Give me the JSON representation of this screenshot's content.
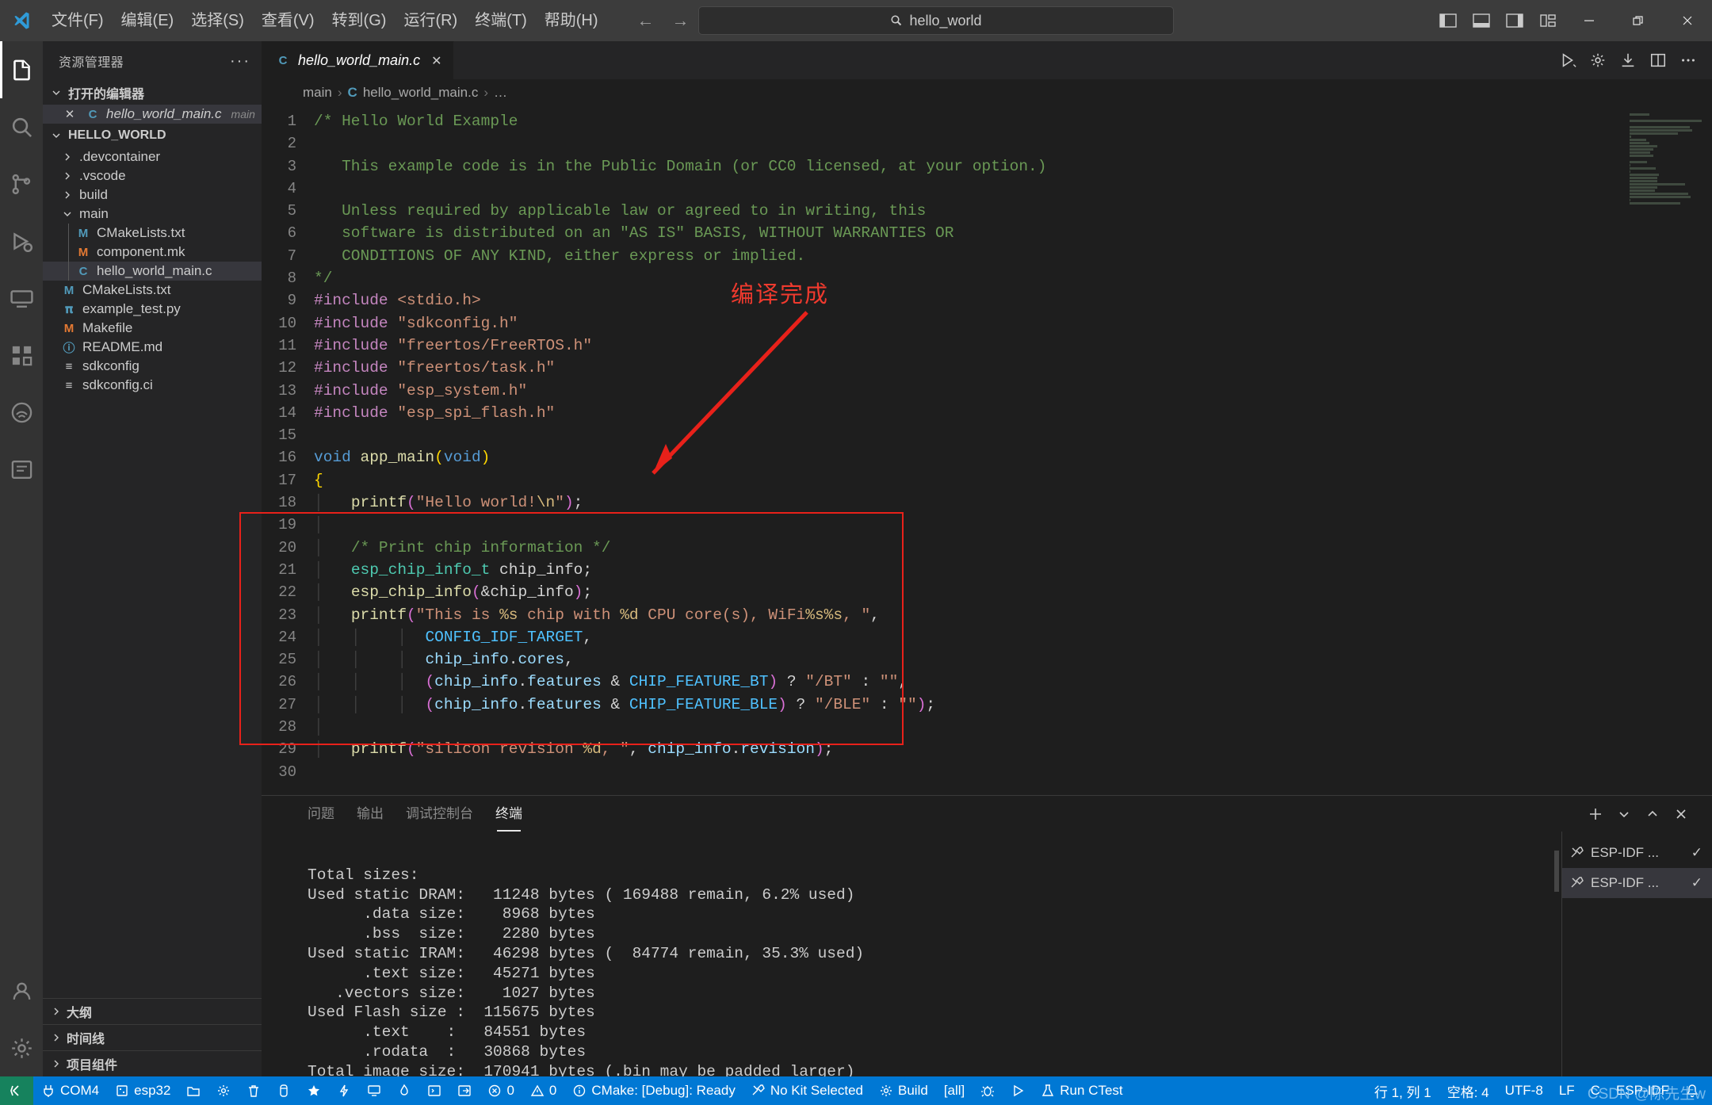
{
  "titlebar": {
    "logo_icon": "vscode-logo",
    "menus": [
      "文件(F)",
      "编辑(E)",
      "选择(S)",
      "查看(V)",
      "转到(G)",
      "运行(R)",
      "终端(T)",
      "帮助(H)"
    ],
    "nav_back_icon": "arrow-left-icon",
    "nav_forward_icon": "arrow-right-icon",
    "search": {
      "text": "hello_world",
      "icon": "search-icon"
    },
    "layout_icons": [
      "toggle-primary-sidebar-icon",
      "toggle-panel-icon",
      "toggle-secondary-sidebar-icon",
      "customize-layout-icon"
    ],
    "window_controls": [
      "minimize-icon",
      "restore-icon",
      "close-icon"
    ]
  },
  "activitybar": {
    "items": [
      {
        "name": "explorer",
        "icon": "files-icon",
        "active": true
      },
      {
        "name": "search",
        "icon": "search-icon",
        "active": false
      },
      {
        "name": "source-control",
        "icon": "source-control-icon",
        "active": false
      },
      {
        "name": "run-and-debug",
        "icon": "debug-icon",
        "active": false
      },
      {
        "name": "remote-explorer",
        "icon": "remote-icon",
        "active": false
      },
      {
        "name": "extensions",
        "icon": "extensions-icon",
        "active": false
      },
      {
        "name": "espressif-idf",
        "icon": "espressif-icon",
        "active": false
      },
      {
        "name": "cmake",
        "icon": "cmake-icon",
        "active": false
      }
    ],
    "bottom_items": [
      {
        "name": "accounts",
        "icon": "account-icon"
      },
      {
        "name": "manage",
        "icon": "gear-icon"
      }
    ]
  },
  "sidebar": {
    "title": "资源管理器",
    "more_actions": "···",
    "open_editors": {
      "label": "打开的编辑器",
      "items": [
        {
          "close": "✕",
          "icon": "c-file-icon",
          "name": "hello_world_main.c",
          "folder": "main",
          "selected": true
        }
      ]
    },
    "project": {
      "label": "HELLO_WORLD",
      "items": [
        {
          "depth": 1,
          "kind": "folder",
          "expanded": false,
          "name": ".devcontainer"
        },
        {
          "depth": 1,
          "kind": "folder",
          "expanded": false,
          "name": ".vscode"
        },
        {
          "depth": 1,
          "kind": "folder",
          "expanded": false,
          "name": "build"
        },
        {
          "depth": 1,
          "kind": "folder",
          "expanded": true,
          "name": "main"
        },
        {
          "depth": 2,
          "kind": "file",
          "icon": "m",
          "name": "CMakeLists.txt"
        },
        {
          "depth": 2,
          "kind": "file",
          "icon": "mk",
          "name": "component.mk"
        },
        {
          "depth": 2,
          "kind": "file",
          "icon": "c",
          "name": "hello_world_main.c",
          "selected": true
        },
        {
          "depth": 1,
          "kind": "file",
          "icon": "m",
          "name": "CMakeLists.txt"
        },
        {
          "depth": 1,
          "kind": "file",
          "icon": "py",
          "name": "example_test.py"
        },
        {
          "depth": 1,
          "kind": "file",
          "icon": "mk",
          "name": "Makefile"
        },
        {
          "depth": 1,
          "kind": "file",
          "icon": "md",
          "name": "README.md"
        },
        {
          "depth": 1,
          "kind": "file",
          "icon": "cfg",
          "name": "sdkconfig"
        },
        {
          "depth": 1,
          "kind": "file",
          "icon": "cfg",
          "name": "sdkconfig.ci"
        }
      ]
    },
    "bottom_sections": [
      "大纲",
      "时间线",
      "项目组件"
    ]
  },
  "editor": {
    "tab": {
      "icon": "c-file-icon",
      "name": "hello_world_main.c",
      "close": "✕"
    },
    "tab_actions": [
      "run-or-debug-icon",
      "settings-gear-icon",
      "download-icon",
      "split-editor-icon",
      "more-actions-icon"
    ],
    "breadcrumb": [
      "main",
      "hello_world_main.c",
      "…"
    ],
    "breadcrumb_sep": "›",
    "first_line": 1,
    "lines": [
      {
        "n": 1,
        "html": "<span class='cmt'>/* Hello World Example</span>"
      },
      {
        "n": 2,
        "html": ""
      },
      {
        "n": 3,
        "html": "<span class='cmt'>   This example code is in the Public Domain (or CC0 licensed, at your option.)</span>"
      },
      {
        "n": 4,
        "html": ""
      },
      {
        "n": 5,
        "html": "<span class='cmt'>   Unless required by applicable law or agreed to in writing, this</span>"
      },
      {
        "n": 6,
        "html": "<span class='cmt'>   software is distributed on an \"AS IS\" BASIS, WITHOUT WARRANTIES OR</span>"
      },
      {
        "n": 7,
        "html": "<span class='cmt'>   CONDITIONS OF ANY KIND, either express or implied.</span>"
      },
      {
        "n": 8,
        "html": "<span class='cmt'>*/</span>"
      },
      {
        "n": 9,
        "html": "<span class='pp'>#include</span> <span class='str'>&lt;stdio.h&gt;</span>"
      },
      {
        "n": 10,
        "html": "<span class='pp'>#include</span> <span class='str'>\"sdkconfig.h\"</span>"
      },
      {
        "n": 11,
        "html": "<span class='pp'>#include</span> <span class='str'>\"freertos/FreeRTOS.h\"</span>"
      },
      {
        "n": 12,
        "html": "<span class='pp'>#include</span> <span class='str'>\"freertos/task.h\"</span>"
      },
      {
        "n": 13,
        "html": "<span class='pp'>#include</span> <span class='str'>\"esp_system.h\"</span>"
      },
      {
        "n": 14,
        "html": "<span class='pp'>#include</span> <span class='str'>\"esp_spi_flash.h\"</span>"
      },
      {
        "n": 15,
        "html": ""
      },
      {
        "n": 16,
        "html": "<span class='kw'>void</span> <span class='fn'>app_main</span><span class='brc'>(</span><span class='kw'>void</span><span class='brc'>)</span>"
      },
      {
        "n": 17,
        "html": "<span class='brc'>{</span>"
      },
      {
        "n": 18,
        "html": "<span class='indentline'>│</span>   <span class='fn'>printf</span><span class='par'>(</span><span class='str'>\"Hello world!</span><span class='esc'>\\n</span><span class='str'>\"</span><span class='par'>)</span>;"
      },
      {
        "n": 19,
        "html": "<span class='indentline'>│</span>"
      },
      {
        "n": 20,
        "html": "<span class='indentline'>│</span>   <span class='cmt'>/* Print chip information */</span>"
      },
      {
        "n": 21,
        "html": "<span class='indentline'>│</span>   <span class='typ'>esp_chip_info_t</span> chip_info;"
      },
      {
        "n": 22,
        "html": "<span class='indentline'>│</span>   <span class='fn'>esp_chip_info</span><span class='par'>(</span>&amp;chip_info<span class='par'>)</span>;"
      },
      {
        "n": 23,
        "html": "<span class='indentline'>│</span>   <span class='fn'>printf</span><span class='par'>(</span><span class='str'>\"This is </span><span class='esc'>%s</span><span class='str'> chip with </span><span class='esc'>%d</span><span class='str'> CPU core(s), WiFi</span><span class='esc'>%s%s</span><span class='str'>, \"</span>,"
      },
      {
        "n": 24,
        "html": "<span class='indentline'>│</span>   <span class='indentline'>│</span>    <span class='indentline'>│</span>  <span class='cst'>CONFIG_IDF_TARGET</span>,"
      },
      {
        "n": 25,
        "html": "<span class='indentline'>│</span>   <span class='indentline'>│</span>    <span class='indentline'>│</span>  <span class='var'>chip_info</span>.<span class='var'>cores</span>,"
      },
      {
        "n": 26,
        "html": "<span class='indentline'>│</span>   <span class='indentline'>│</span>    <span class='indentline'>│</span>  <span class='par'>(</span><span class='var'>chip_info</span>.<span class='var'>features</span> &amp; <span class='cst'>CHIP_FEATURE_BT</span><span class='par'>)</span> ? <span class='str'>\"/BT\"</span> : <span class='str'>\"\"</span>,"
      },
      {
        "n": 27,
        "html": "<span class='indentline'>│</span>   <span class='indentline'>│</span>    <span class='indentline'>│</span>  <span class='par'>(</span><span class='var'>chip_info</span>.<span class='var'>features</span> &amp; <span class='cst'>CHIP_FEATURE_BLE</span><span class='par'>)</span> ? <span class='str'>\"/BLE\"</span> : <span class='str'>\"\"</span><span class='par'>)</span>;"
      },
      {
        "n": 28,
        "html": "<span class='indentline'>│</span>"
      },
      {
        "n": 29,
        "html": "<span class='indentline'>│</span>   <span class='fn'>printf</span><span class='par'>(</span><span class='str'>\"silicon revision </span><span class='esc'>%d</span><span class='str'>, \"</span>, <span class='var'>chip_info</span>.<span class='var'>revision</span><span class='par'>)</span>;"
      },
      {
        "n": 30,
        "html": ""
      }
    ],
    "annotation": {
      "text": "编译完成",
      "color": "#f03a2e",
      "arrow_icon": "arrow-pointer"
    }
  },
  "panel": {
    "tabs": [
      {
        "label": "问题",
        "active": false
      },
      {
        "label": "输出",
        "active": false
      },
      {
        "label": "调试控制台",
        "active": false
      },
      {
        "label": "终端",
        "active": true
      }
    ],
    "actions": [
      "add-terminal-icon",
      "chevron-down-icon",
      "maximize-panel-icon",
      "close-panel-icon"
    ],
    "terminal_output": [
      "Total sizes:",
      "Used static DRAM:   11248 bytes ( 169488 remain, 6.2% used)",
      "      .data size:    8968 bytes",
      "      .bss  size:    2280 bytes",
      "Used static IRAM:   46298 bytes (  84774 remain, 35.3% used)",
      "      .text size:   45271 bytes",
      "   .vectors size:    1027 bytes",
      "Used Flash size :  115675 bytes",
      "      .text    :   84551 bytes",
      "      .rodata  :   30868 bytes",
      "Total image size:  170941 bytes (.bin may be padded larger)"
    ],
    "terminal_list": [
      {
        "icon": "tools-icon",
        "label": "ESP-IDF ...",
        "check": "✓",
        "selected": false
      },
      {
        "icon": "tools-icon",
        "label": "ESP-IDF ...",
        "check": "✓",
        "selected": true
      }
    ]
  },
  "statusbar": {
    "remote_icon": "remote-window-icon",
    "left_items": [
      {
        "icon": "plug-icon",
        "label": "COM4"
      },
      {
        "icon": "chip-icon",
        "label": "esp32"
      },
      {
        "icon": "folder-icon",
        "label": ""
      },
      {
        "icon": "gear-icon",
        "label": ""
      },
      {
        "icon": "trash-icon",
        "label": ""
      },
      {
        "icon": "database-icon",
        "label": ""
      },
      {
        "icon": "star-icon",
        "label": ""
      },
      {
        "icon": "lightning-icon",
        "label": ""
      },
      {
        "icon": "monitor-icon",
        "label": ""
      },
      {
        "icon": "flame-icon",
        "label": ""
      },
      {
        "icon": "terminal-icon",
        "label": ""
      },
      {
        "icon": "signin-icon",
        "label": ""
      },
      {
        "icon": "error-icon",
        "label": "0"
      },
      {
        "icon": "warning-icon",
        "label": "0"
      },
      {
        "icon": "info-icon",
        "label": "CMake: [Debug]: Ready"
      },
      {
        "icon": "tools-icon",
        "label": "No Kit Selected"
      },
      {
        "icon": "gear-icon",
        "label": "Build"
      },
      {
        "icon": "",
        "label": "[all]"
      },
      {
        "icon": "bug-icon",
        "label": ""
      },
      {
        "icon": "play-icon",
        "label": ""
      },
      {
        "icon": "beaker-icon",
        "label": "Run CTest"
      }
    ],
    "right_items": [
      {
        "icon": "",
        "label": "行 1, 列 1"
      },
      {
        "icon": "",
        "label": "空格: 4"
      },
      {
        "icon": "",
        "label": "UTF-8"
      },
      {
        "icon": "",
        "label": "LF"
      },
      {
        "icon": "",
        "label": "C"
      },
      {
        "icon": "",
        "label": "ESP-IDF"
      },
      {
        "icon": "bell-icon",
        "label": ""
      }
    ],
    "watermark": "CSDN @陈先生w"
  }
}
